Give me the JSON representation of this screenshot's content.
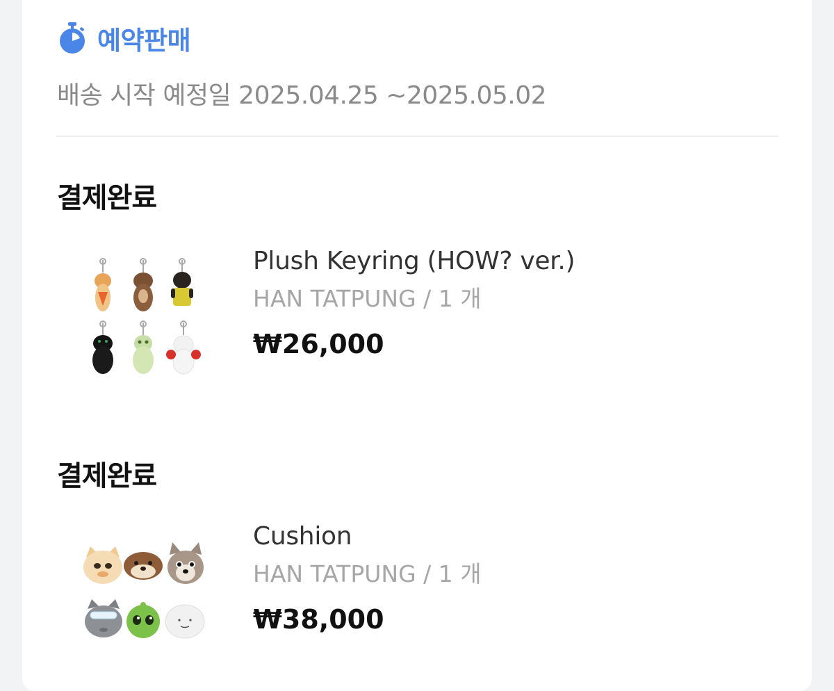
{
  "presale": {
    "icon": "stopwatch-icon",
    "label": "예약판매",
    "accent_color": "#4a86e8"
  },
  "shipping": {
    "text": "배송 시작 예정일 2025.04.25 ~2025.05.02"
  },
  "orders": [
    {
      "status": "결제완료",
      "name": "Plush Keyring (HOW? ver.)",
      "option": "HAN TATPUNG / 1 개",
      "price": "₩26,000",
      "thumbnail": "plush-keyring-set-image"
    },
    {
      "status": "결제완료",
      "name": "Cushion",
      "option": "HAN TATPUNG / 1 개",
      "price": "₩38,000",
      "thumbnail": "cushion-set-image"
    }
  ]
}
